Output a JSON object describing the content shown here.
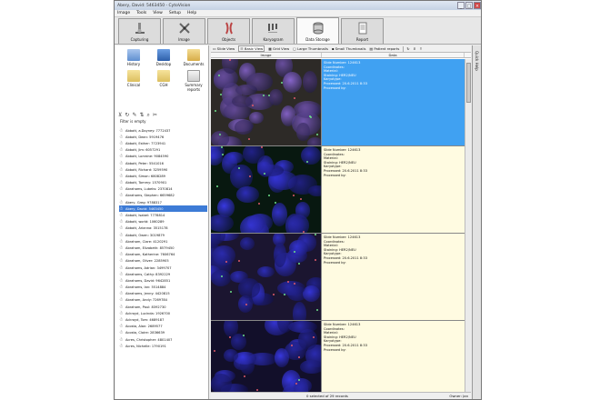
{
  "window": {
    "title": "Abery, David: 5463450 - CytoVision"
  },
  "menu": [
    "Image",
    "Tools",
    "View",
    "Setup",
    "Help"
  ],
  "tabs": [
    {
      "label": "Capturing",
      "icon": "microscope-icon"
    },
    {
      "label": "Image",
      "icon": "chromosome-icon"
    },
    {
      "label": "Objects",
      "icon": "objects-icon"
    },
    {
      "label": "Karyogram",
      "icon": "karyogram-icon"
    },
    {
      "label": "Data Storage",
      "icon": "database-icon"
    },
    {
      "label": "Report",
      "icon": "report-icon"
    }
  ],
  "launch": [
    {
      "label": "History",
      "icon": "history-icon",
      "color": "#6b9bd6"
    },
    {
      "label": "Desktop",
      "icon": "desktop-icon",
      "color": "#3a6fbf"
    },
    {
      "label": "Documents",
      "icon": "documents-icon",
      "color": "#e7c46a"
    },
    {
      "label": "Clinical",
      "icon": "folder-icon",
      "color": "#e9d27b"
    },
    {
      "label": "CGH",
      "icon": "folder-icon",
      "color": "#e9d27b"
    },
    {
      "label": "Summary reports",
      "icon": "report-icon",
      "color": "#d8d8d8"
    }
  ],
  "filter_label": "Filter is empty",
  "patients": [
    {
      "name": "Abbott, a.Doyney: 7772437"
    },
    {
      "name": "Abbott, Dean: 5919476"
    },
    {
      "name": "Abbott, Esther: 7723941"
    },
    {
      "name": "Abbott, Jim: 6057291"
    },
    {
      "name": "Abbott, Lorraine: 9084590"
    },
    {
      "name": "Abbott, Peter: 5541016"
    },
    {
      "name": "Abbott, Richard: 3259590"
    },
    {
      "name": "Abbott, Simon: 6808289"
    },
    {
      "name": "Abbott, Tommy: 1570901"
    },
    {
      "name": "Abrahams, Lubeks: 2370814"
    },
    {
      "name": "Abrahams, Stephen: 6659682"
    },
    {
      "name": "Abery, Greg: 9788317"
    },
    {
      "name": "Abery, David: 5463450",
      "selected": true
    },
    {
      "name": "Abbott, Isabel: 7778814"
    },
    {
      "name": "Abbott, world: 1060289"
    },
    {
      "name": "Abbott, Arianna: 3515178"
    },
    {
      "name": "Abbott, Owen: 3019879"
    },
    {
      "name": "Abraham, Clare: 4120291"
    },
    {
      "name": "Abraham, Elizabeth: 8579450"
    },
    {
      "name": "Abraham, Katherine: 7606764"
    },
    {
      "name": "Abraham, Oliver: 2285905"
    },
    {
      "name": "Abrahams, Adrian: 3499707"
    },
    {
      "name": "Abrahams, Cathy: 8392229"
    },
    {
      "name": "Abrahams, David: 9642851"
    },
    {
      "name": "Abrahams, Ian: 5514884"
    },
    {
      "name": "Abrahams, Jenny: 4420815"
    },
    {
      "name": "Abraham, Andy: 7269784"
    },
    {
      "name": "Abraham, Paul: 8392730"
    },
    {
      "name": "Ackroyd, Lucinda: 1926700"
    },
    {
      "name": "Ackroyd, Tom: 4689187"
    },
    {
      "name": "Acosta, Alan: 2689577"
    },
    {
      "name": "Acosta, Claire: 2836639"
    },
    {
      "name": "Acres, Christopher: 4801407"
    },
    {
      "name": "Acres, Nichelle: 1790191"
    }
  ],
  "views": {
    "slide": "Slide View",
    "basic": "Basic View",
    "grid": "Grid View",
    "large": "Large Thumbnails",
    "small": "Small Thumbnails",
    "reports": "Patient reports"
  },
  "table": {
    "col_image": "Image",
    "col_data": "Data"
  },
  "records": [
    {
      "slide": "Slide Number: 124613",
      "coords": "Coordinates:",
      "material": "Material:",
      "staining": "Staining: HER2/NEU",
      "karyotype": "Karyotype:",
      "processed": "Processed: 20.6.2011 8:33",
      "by": "Processed by:",
      "selected": true
    },
    {
      "slide": "Slide Number: 124613",
      "coords": "Coordinates:",
      "material": "Material:",
      "staining": "Staining: HER2/NEU",
      "karyotype": "Karyotype:",
      "processed": "Processed: 20.6.2011 8:33",
      "by": "Processed by:"
    },
    {
      "slide": "Slide Number: 124613",
      "coords": "Coordinates:",
      "material": "Material:",
      "staining": "Staining: HER2/NEU",
      "karyotype": "Karyotype:",
      "processed": "Processed: 20.6.2011 8:33",
      "by": "Processed by:"
    },
    {
      "slide": "Slide Number: 124613",
      "coords": "Coordinates:",
      "material": "Material:",
      "staining": "Staining: HER2/NEU",
      "karyotype": "Karyotype:",
      "processed": "Processed: 20.6.2011 8:33",
      "by": "Processed by:"
    }
  ],
  "status": {
    "center": "0 selected of 29 records",
    "right": "Owner: Jan"
  },
  "quick_help": "Quick Help",
  "colors": {
    "selected_row": "#40a1f2",
    "info_bg": "#fffbe1",
    "list_selection": "#3d7bd6"
  }
}
